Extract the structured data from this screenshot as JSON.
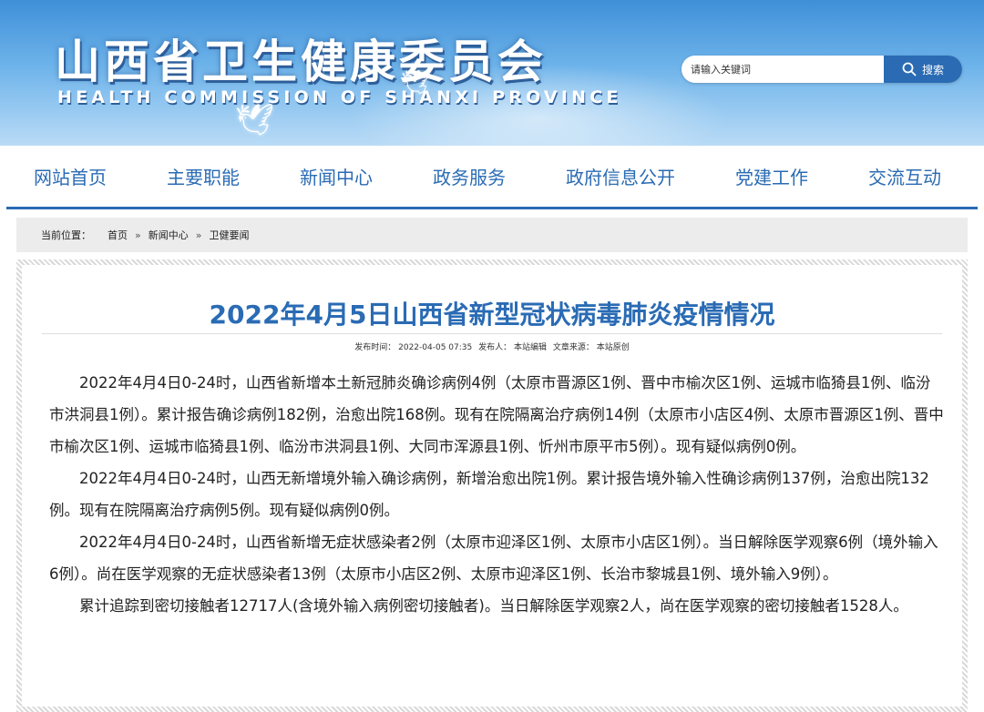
{
  "header": {
    "title": "山西省卫生健康委员会",
    "subtitle": "HEALTH COMMISSION OF SHANXI PROVINCE",
    "search_placeholder": "请输入关键词",
    "search_button": "搜索"
  },
  "nav": {
    "items": [
      "网站首页",
      "主要职能",
      "新闻中心",
      "政务服务",
      "政府信息公开",
      "党建工作",
      "交流互动"
    ]
  },
  "breadcrumb": {
    "label": "当前位置：",
    "items": [
      "首页",
      "新闻中心",
      "卫健要闻"
    ],
    "separator": "»"
  },
  "article": {
    "title": "2022年4月5日山西省新型冠状病毒肺炎疫情情况",
    "meta": {
      "publish_time": "发布时间： 2022-04-05 07:35",
      "publisher": "发布人： 本站编辑",
      "source": "文章来源： 本站原创"
    },
    "paragraphs": [
      "2022年4月4日0-24时，山西省新增本土新冠肺炎确诊病例4例（太原市晋源区1例、晋中市榆次区1例、运城市临猗县1例、临汾市洪洞县1例）。累计报告确诊病例182例，治愈出院168例。现有在院隔离治疗病例14例（太原市小店区4例、太原市晋源区1例、晋中市榆次区1例、运城市临猗县1例、临汾市洪洞县1例、大同市浑源县1例、忻州市原平市5例）。现有疑似病例0例。",
      "2022年4月4日0-24时，山西无新增境外输入确诊病例，新增治愈出院1例。累计报告境外输入性确诊病例137例，治愈出院132例。现有在院隔离治疗病例5例。现有疑似病例0例。",
      "2022年4月4日0-24时，山西省新增无症状感染者2例（太原市迎泽区1例、太原市小店区1例）。当日解除医学观察6例（境外输入6例）。尚在医学观察的无症状感染者13例（太原市小店区2例、太原市迎泽区1例、长治市黎城县1例、境外输入9例）。",
      "累计追踪到密切接触者12717人(含境外输入病例密切接触者)。当日解除医学观察2人，尚在医学观察的密切接触者1528人。"
    ]
  },
  "colors": {
    "brand_blue": "#2a6bb4",
    "banner_top": "#3f8fd8",
    "breadcrumb_bg": "#ececec"
  }
}
